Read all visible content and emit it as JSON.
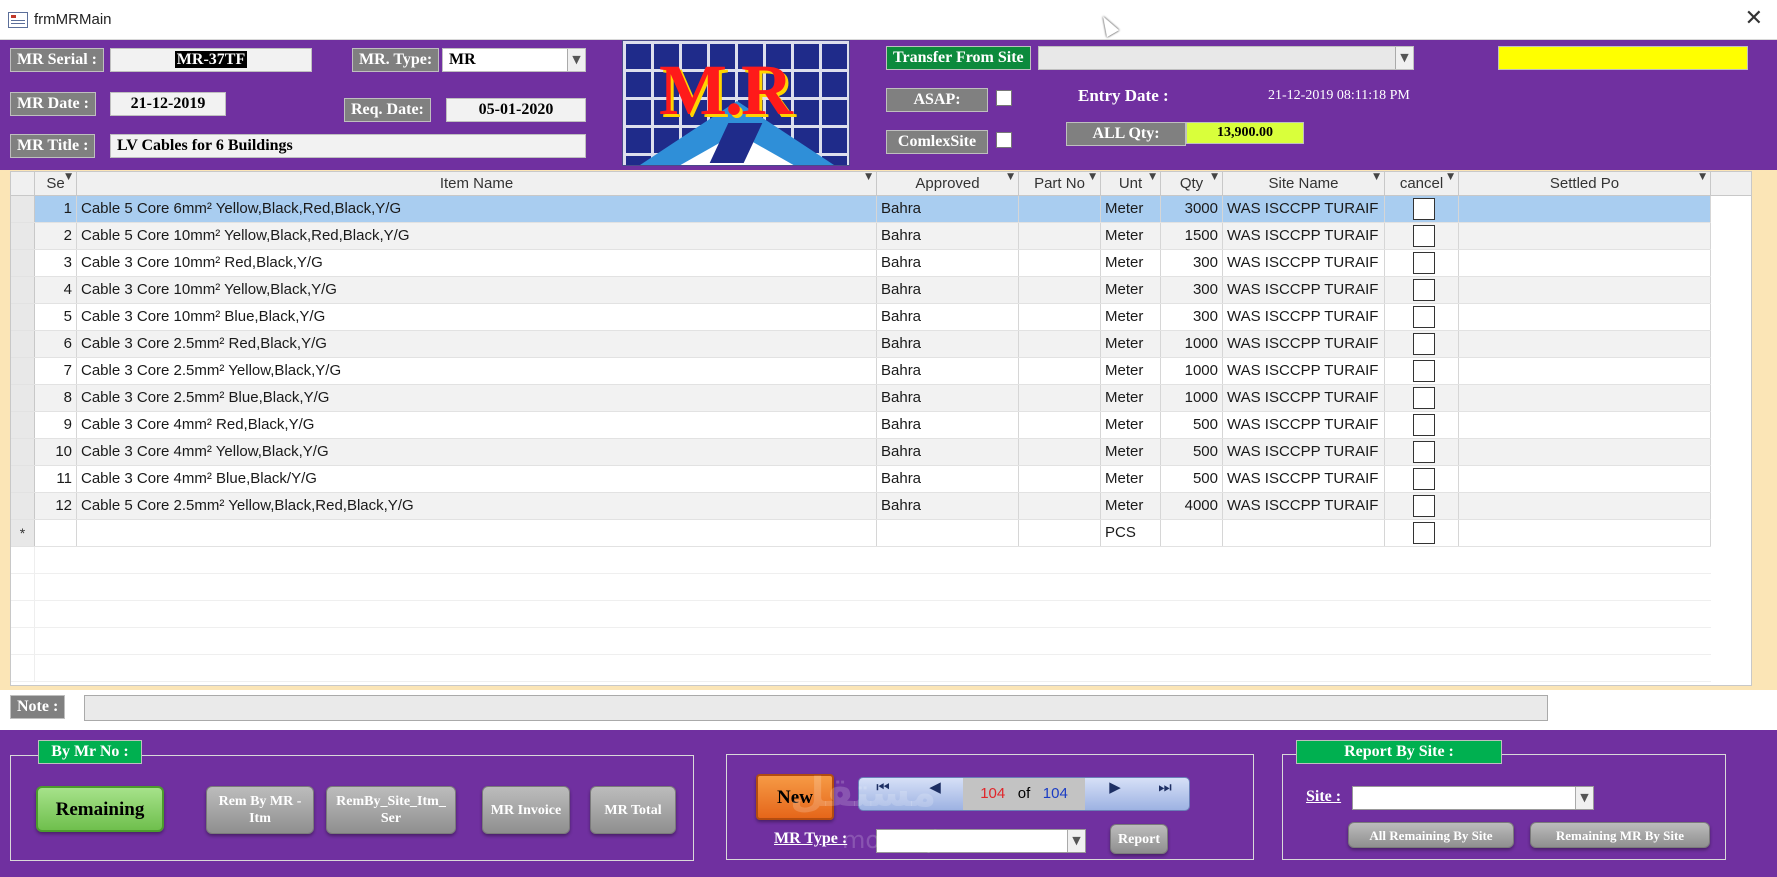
{
  "window": {
    "title": "frmMRMain",
    "close_glyph": "✕"
  },
  "header": {
    "mr_serial_label": "MR Serial  :",
    "mr_serial_value": "MR-37TF",
    "mr_type_label": "MR. Type:",
    "mr_type_value": "MR",
    "mr_date_label": "MR Date :",
    "mr_date_value": "21-12-2019",
    "req_date_label": "Req. Date:",
    "req_date_value": "05-01-2020",
    "mr_title_label": "MR Title :",
    "mr_title_value": "LV Cables for 6 Buildings",
    "transfer_from_site_label": "Transfer From Site",
    "transfer_from_site_value": "",
    "asap_label": "ASAP:",
    "comlexsite_label": "ComlexSite",
    "entry_date_label": "Entry Date :",
    "entry_date_value": "21-12-2019 08:11:18 PM",
    "all_qty_label": "ALL Qty:",
    "all_qty_value": "13,900.00",
    "yellow_field_value": "",
    "logo_text": "M.R",
    "colors": {
      "purple": "#7030a0",
      "yellow": "#ffff00",
      "qty_yellow": "#d9ff3b",
      "green_label": "#00b050"
    }
  },
  "grid": {
    "columns": [
      "Se",
      "Item Name",
      "Approved",
      "Part No",
      "Unt",
      "Qty",
      "Site Name",
      "cancel",
      "Settled Po"
    ],
    "rows": [
      {
        "se": "1",
        "item": "Cable 5 Core 6mm² Yellow,Black,Red,Black,Y/G",
        "approved": "Bahra",
        "part": "",
        "unit": "Meter",
        "qty": "3000",
        "site": "WAS ISCCPP TURAIF"
      },
      {
        "se": "2",
        "item": "Cable 5 Core 10mm² Yellow,Black,Red,Black,Y/G",
        "approved": "Bahra",
        "part": "",
        "unit": "Meter",
        "qty": "1500",
        "site": "WAS ISCCPP TURAIF"
      },
      {
        "se": "3",
        "item": "Cable 3 Core 10mm² Red,Black,Y/G",
        "approved": "Bahra",
        "part": "",
        "unit": "Meter",
        "qty": "300",
        "site": "WAS ISCCPP TURAIF"
      },
      {
        "se": "4",
        "item": "Cable 3 Core 10mm²  Yellow,Black,Y/G",
        "approved": "Bahra",
        "part": "",
        "unit": "Meter",
        "qty": "300",
        "site": "WAS ISCCPP TURAIF"
      },
      {
        "se": "5",
        "item": "Cable 3 Core 10mm² Blue,Black,Y/G",
        "approved": "Bahra",
        "part": "",
        "unit": "Meter",
        "qty": "300",
        "site": "WAS ISCCPP TURAIF"
      },
      {
        "se": "6",
        "item": "Cable 3 Core 2.5mm² Red,Black,Y/G",
        "approved": "Bahra",
        "part": "",
        "unit": "Meter",
        "qty": "1000",
        "site": "WAS ISCCPP TURAIF"
      },
      {
        "se": "7",
        "item": "Cable 3 Core 2.5mm² Yellow,Black,Y/G",
        "approved": "Bahra",
        "part": "",
        "unit": "Meter",
        "qty": "1000",
        "site": "WAS ISCCPP TURAIF"
      },
      {
        "se": "8",
        "item": "Cable 3 Core 2.5mm² Blue,Black,Y/G",
        "approved": "Bahra",
        "part": "",
        "unit": "Meter",
        "qty": "1000",
        "site": "WAS ISCCPP TURAIF"
      },
      {
        "se": "9",
        "item": "Cable 3 Core 4mm² Red,Black,Y/G",
        "approved": "Bahra",
        "part": "",
        "unit": "Meter",
        "qty": "500",
        "site": "WAS ISCCPP TURAIF"
      },
      {
        "se": "10",
        "item": "Cable 3 Core 4mm² Yellow,Black,Y/G",
        "approved": "Bahra",
        "part": "",
        "unit": "Meter",
        "qty": "500",
        "site": "WAS ISCCPP TURAIF"
      },
      {
        "se": "11",
        "item": "Cable 3 Core 4mm² Blue,Black/Y/G",
        "approved": "Bahra",
        "part": "",
        "unit": "Meter",
        "qty": "500",
        "site": "WAS ISCCPP TURAIF"
      },
      {
        "se": "12",
        "item": "Cable 5 Core 2.5mm² Yellow,Black,Red,Black,Y/G",
        "approved": "Bahra",
        "part": "",
        "unit": "Meter",
        "qty": "4000",
        "site": "WAS ISCCPP TURAIF"
      }
    ],
    "new_row": {
      "marker": "*",
      "unit": "PCS"
    }
  },
  "note": {
    "label": "Note :",
    "value": ""
  },
  "footer": {
    "by_mr_no_label": "By Mr No :",
    "remaining": "Remaining",
    "rem_by_mr_itm": "Rem By MR - Itm",
    "remby_site_itm_ser": "RemBy_Site_Itm_ Ser",
    "mr_invoice": "MR Invoice",
    "mr_total": "MR Total",
    "new": "New",
    "nav_current": "104",
    "nav_of": "of",
    "nav_total": "104",
    "mr_type_label": "MR Type :",
    "report": "Report",
    "report_by_site_label": "Report By Site :",
    "site_label": "Site :",
    "all_remaining_by_site": "All Remaining By Site",
    "remaining_mr_by_site": "Remaining MR By Site"
  },
  "watermark": {
    "text": "مستقل",
    "url": "mostaql.com"
  }
}
